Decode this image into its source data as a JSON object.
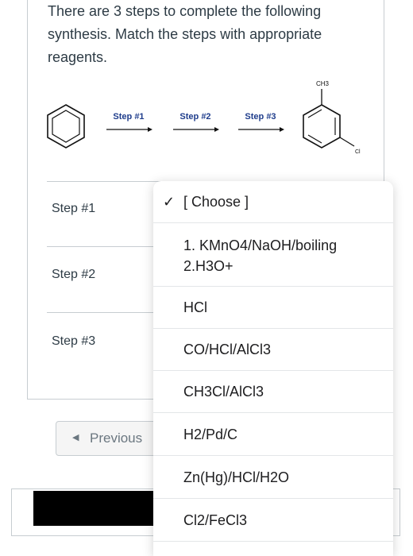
{
  "question": {
    "text": "There are 3 steps to complete the following synthesis. Match the steps with appropriate reagents."
  },
  "scheme": {
    "arrow_labels": [
      "Step #1",
      "Step #2",
      "Step #3"
    ],
    "product_substituents": [
      "CH3",
      "Cl"
    ]
  },
  "steps": [
    {
      "label": "Step #1"
    },
    {
      "label": "Step #2"
    },
    {
      "label": "Step #3"
    }
  ],
  "nav": {
    "previous_label": "Previous"
  },
  "dropdown": {
    "options": [
      {
        "text": "[ Choose ]",
        "selected": true
      },
      {
        "text": "1. KMnO4/NaOH/boiling",
        "text2": "2.H3O+"
      },
      {
        "text": "HCl"
      },
      {
        "text": "CO/HCl/AlCl3"
      },
      {
        "text": "CH3Cl/AlCl3"
      },
      {
        "text": "H2/Pd/C"
      },
      {
        "text": "Zn(Hg)/HCl/H2O"
      },
      {
        "text": "Cl2/FeCl3"
      }
    ]
  },
  "colors": {
    "step_label_blue": "#1f3d8c",
    "border": "#c7cdd1"
  }
}
